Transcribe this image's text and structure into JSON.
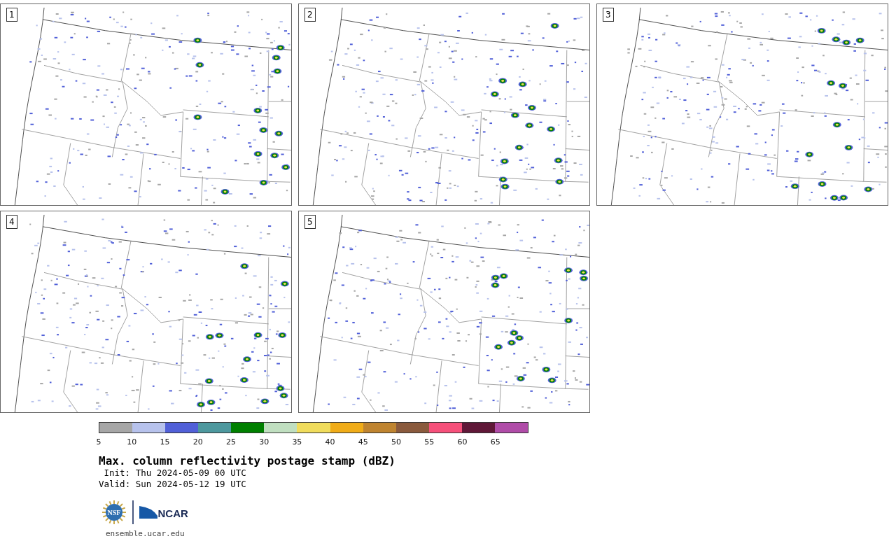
{
  "panels": [
    {
      "label": "1"
    },
    {
      "label": "2"
    },
    {
      "label": "3"
    },
    {
      "label": "4"
    },
    {
      "label": "5"
    }
  ],
  "colorbar": {
    "segments": [
      {
        "color": "#a6a6a6"
      },
      {
        "color": "#b7c2ec"
      },
      {
        "color": "#5160d8"
      },
      {
        "color": "#4d989e"
      },
      {
        "color": "#008000"
      },
      {
        "color": "#c0dfc0"
      },
      {
        "color": "#f0dc5c"
      },
      {
        "color": "#f0ac18"
      },
      {
        "color": "#bf8430"
      },
      {
        "color": "#8a5a3d"
      },
      {
        "color": "#f6507a"
      },
      {
        "color": "#601838"
      },
      {
        "color": "#b04ca8"
      }
    ],
    "ticks": [
      "5",
      "10",
      "15",
      "20",
      "25",
      "30",
      "35",
      "40",
      "45",
      "50",
      "55",
      "60",
      "65"
    ]
  },
  "title": "Max. column reflectivity postage stamp (dBZ)",
  "init": "Init: Thu 2024-05-09 00 UTC",
  "valid": "Valid: Sun 2024-05-12 19 UTC",
  "logos": {
    "nsf": "NSF",
    "ncar": "NCAR"
  },
  "footer": "ensemble.ucar.edu"
}
